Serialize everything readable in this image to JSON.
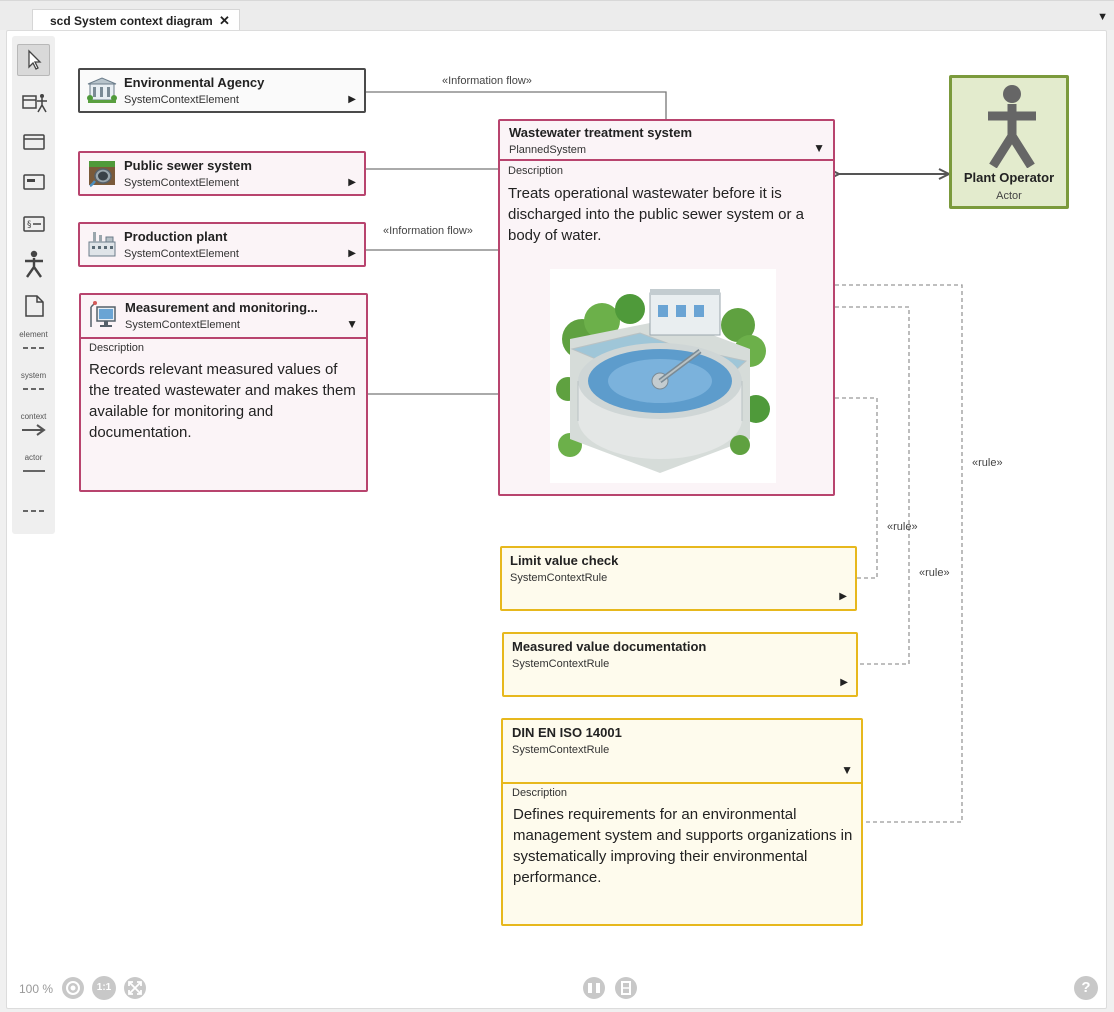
{
  "tab": {
    "label": "scd System context diagram",
    "close": "✕",
    "menu": "▼"
  },
  "palette": {
    "labels": {
      "element": "element",
      "system": "system",
      "context": "context",
      "actor": "actor"
    }
  },
  "nodes": {
    "env_agency": {
      "title": "Environmental Agency",
      "type": "SystemContextElement",
      "expand": "▶"
    },
    "sewer": {
      "title": "Public sewer system",
      "type": "SystemContextElement",
      "expand": "▶"
    },
    "production": {
      "title": "Production plant",
      "type": "SystemContextElement",
      "expand": "▶"
    },
    "measurement": {
      "title": "Measurement and monitoring...",
      "type": "SystemContextElement",
      "expand": "▼",
      "desc_label": "Description",
      "desc": "Records relevant measured values of the treated wastewater and makes them available for monitoring and documentation."
    },
    "wwts": {
      "title": "Wastewater treatment system",
      "type": "PlannedSystem",
      "expand": "▼",
      "desc_label": "Description",
      "desc": "Treats operational wastewater before it is discharged into the public sewer system or a body of water."
    },
    "limit": {
      "title": "Limit value check",
      "type": "SystemContextRule",
      "expand": "▶"
    },
    "docu": {
      "title": "Measured value documentation",
      "type": "SystemContextRule",
      "expand": "▶"
    },
    "iso": {
      "title": "DIN EN ISO 14001",
      "type": "SystemContextRule",
      "expand": "▼",
      "desc_label": "Description",
      "desc": "Defines requirements for an environmental management system and supports organizations in systematically improving their environmental performance."
    }
  },
  "actor": {
    "name": "Plant Operator",
    "type": "Actor"
  },
  "connector_labels": {
    "info_flow_1": "«Information flow»",
    "info_flow_2": "«Information flow»",
    "rule_1": "«rule»",
    "rule_2": "«rule»",
    "rule_3": "«rule»"
  },
  "statusbar": {
    "zoom": "100 %",
    "one_to_one": "1:1",
    "help": "?"
  },
  "colors": {
    "system_border": "#b8446e",
    "rule_border": "#e7b81d",
    "actor_border": "#7b9a3c",
    "actor_fill": "#e3ebcd"
  }
}
